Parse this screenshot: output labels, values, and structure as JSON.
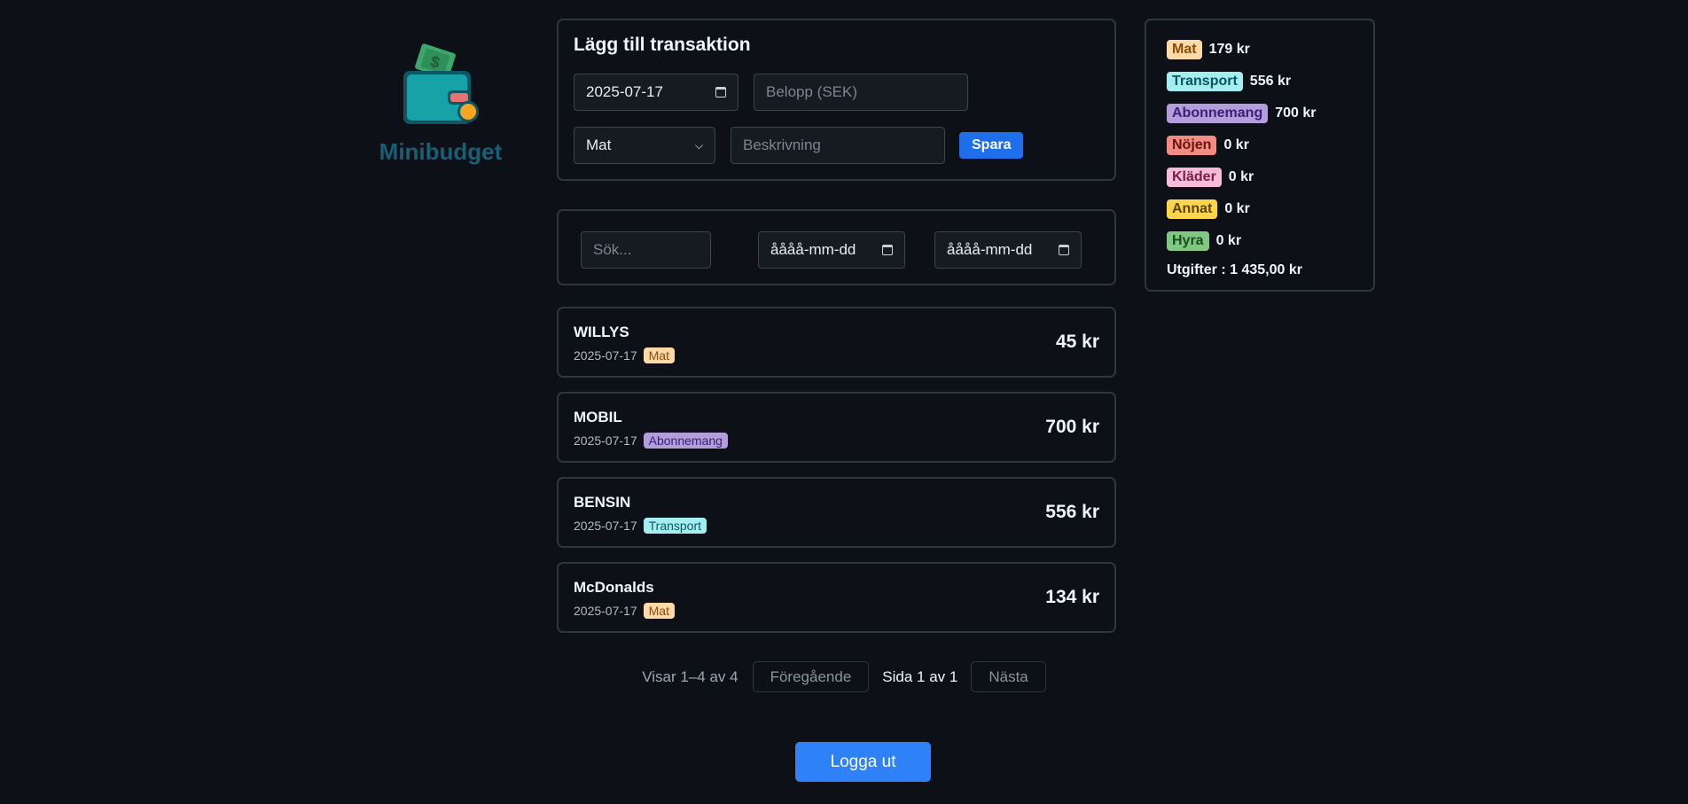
{
  "brand": {
    "name": "Minibudget"
  },
  "add_form": {
    "title": "Lägg till transaktion",
    "date_value": "2025-07-17",
    "amount_placeholder": "Belopp (SEK)",
    "category_selected": "Mat",
    "description_placeholder": "Beskrivning",
    "save_label": "Spara"
  },
  "filters": {
    "search_placeholder": "Sök...",
    "from_date_placeholder": "åååå-mm-dd",
    "to_date_placeholder": "åååå-mm-dd"
  },
  "transactions": [
    {
      "name": "WILLYS",
      "date": "2025-07-17",
      "category": "Mat",
      "amount": "45 kr"
    },
    {
      "name": "MOBIL",
      "date": "2025-07-17",
      "category": "Abonnemang",
      "amount": "700 kr"
    },
    {
      "name": "BENSIN",
      "date": "2025-07-17",
      "category": "Transport",
      "amount": "556 kr"
    },
    {
      "name": "McDonalds",
      "date": "2025-07-17",
      "category": "Mat",
      "amount": "134 kr"
    }
  ],
  "pagination": {
    "showing": "Visar 1–4 av 4",
    "prev_label": "Föregående",
    "page_info": "Sida 1 av 1",
    "next_label": "Nästa"
  },
  "logout_label": "Logga ut",
  "summary": {
    "categories": [
      {
        "name": "Mat",
        "amount": "179 kr"
      },
      {
        "name": "Transport",
        "amount": "556 kr"
      },
      {
        "name": "Abonnemang",
        "amount": "700 kr"
      },
      {
        "name": "Nöjen",
        "amount": "0 kr"
      },
      {
        "name": "Kläder",
        "amount": "0 kr"
      },
      {
        "name": "Annat",
        "amount": "0 kr"
      },
      {
        "name": "Hyra",
        "amount": "0 kr"
      }
    ],
    "total": "Utgifter : 1 435,00 kr"
  },
  "category_colors": {
    "Mat": {
      "bg": "#ffd9a8",
      "fg": "#8a4b08"
    },
    "Transport": {
      "bg": "#a5eef0",
      "fg": "#0b5560"
    },
    "Abonnemang": {
      "bg": "#b39ddb",
      "fg": "#3a1f78"
    },
    "Nöjen": {
      "bg": "#f28b82",
      "fg": "#6b1410"
    },
    "Kläder": {
      "bg": "#f8bbd9",
      "fg": "#7a1d4a"
    },
    "Annat": {
      "bg": "#ffd54f",
      "fg": "#5c4300"
    },
    "Hyra": {
      "bg": "#81c784",
      "fg": "#1b4d1e"
    }
  },
  "colors": {
    "accent": "#1f6feb",
    "logout": "#2f81f7",
    "background": "#0d1117",
    "brand_text": "#1a5e73"
  }
}
